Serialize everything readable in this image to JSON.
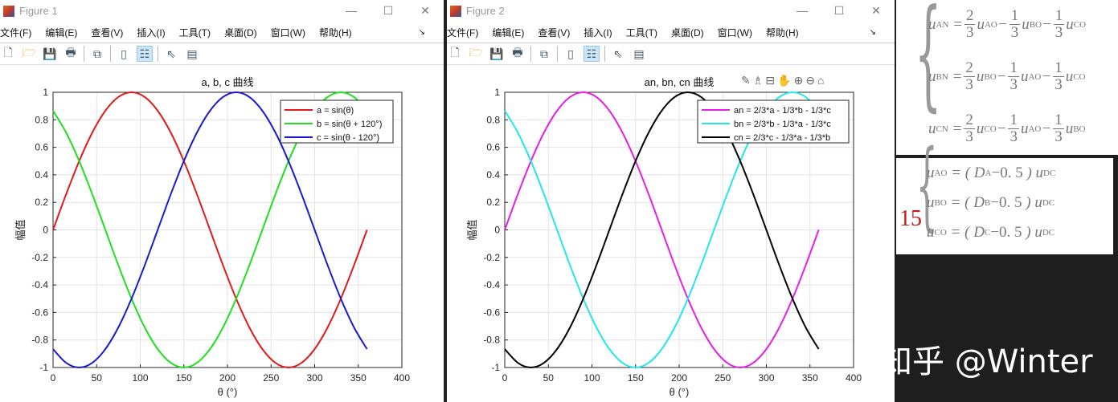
{
  "menus": [
    "文件(F)",
    "编辑(E)",
    "查看(V)",
    "插入(I)",
    "工具(T)",
    "桌面(D)",
    "窗口(W)",
    "帮助(H)"
  ],
  "window_controls": {
    "minimize": "—",
    "maximize": "☐",
    "close": "✕"
  },
  "figures": [
    {
      "title": "Figure 1"
    },
    {
      "title": "Figure 2"
    }
  ],
  "chart_data": [
    {
      "type": "line",
      "title": "a, b, c 曲线",
      "xlabel": "θ (°)",
      "ylabel": "幅值",
      "xlim": [
        0,
        400
      ],
      "ylim": [
        -1,
        1
      ],
      "grid": true,
      "legend_position": "top-right",
      "xticks": [
        0,
        50,
        100,
        150,
        200,
        250,
        300,
        350,
        400
      ],
      "yticks": [
        -1,
        -0.8,
        -0.6,
        -0.4,
        -0.2,
        0,
        0.2,
        0.4,
        0.6,
        0.8,
        1
      ],
      "x": [
        0,
        15,
        30,
        45,
        60,
        75,
        90,
        105,
        120,
        135,
        150,
        165,
        180,
        195,
        210,
        225,
        240,
        255,
        270,
        285,
        300,
        315,
        330,
        345,
        360
      ],
      "series": [
        {
          "name": "a = sin(θ)",
          "color": "#e01b1b",
          "values": [
            0,
            0.259,
            0.5,
            0.707,
            0.866,
            0.966,
            1,
            0.966,
            0.866,
            0.707,
            0.5,
            0.259,
            0,
            -0.259,
            -0.5,
            -0.707,
            -0.866,
            -0.966,
            -1,
            -0.966,
            -0.866,
            -0.707,
            -0.5,
            -0.259,
            0
          ]
        },
        {
          "name": "b = sin(θ + 120°)",
          "color": "#1ee01e",
          "values": [
            0.866,
            0.707,
            0.5,
            0.259,
            0,
            -0.259,
            -0.5,
            -0.707,
            -0.866,
            -0.966,
            -1,
            -0.966,
            -0.866,
            -0.707,
            -0.5,
            -0.259,
            0,
            0.259,
            0.5,
            0.707,
            0.866,
            0.966,
            1,
            0.966,
            0.866
          ]
        },
        {
          "name": "c = sin(θ - 120°)",
          "color": "#1a1acc",
          "values": [
            -0.866,
            -0.966,
            -1,
            -0.966,
            -0.866,
            -0.707,
            -0.5,
            -0.259,
            0,
            0.259,
            0.5,
            0.707,
            0.866,
            0.966,
            1,
            0.966,
            0.866,
            0.707,
            0.5,
            0.259,
            0,
            -0.259,
            -0.5,
            -0.707,
            -0.866
          ]
        }
      ]
    },
    {
      "type": "line",
      "title": "an, bn, cn 曲线",
      "xlabel": "θ (°)",
      "ylabel": "幅值",
      "xlim": [
        0,
        400
      ],
      "ylim": [
        -1,
        1
      ],
      "grid": true,
      "legend_position": "top-right",
      "xticks": [
        0,
        50,
        100,
        150,
        200,
        250,
        300,
        350,
        400
      ],
      "yticks": [
        -1,
        -0.8,
        -0.6,
        -0.4,
        -0.2,
        0,
        0.2,
        0.4,
        0.6,
        0.8,
        1
      ],
      "x": [
        0,
        15,
        30,
        45,
        60,
        75,
        90,
        105,
        120,
        135,
        150,
        165,
        180,
        195,
        210,
        225,
        240,
        255,
        270,
        285,
        300,
        315,
        330,
        345,
        360
      ],
      "series": [
        {
          "name": "an = 2/3*a - 1/3*b - 1/3*c",
          "color": "#e61ee6",
          "values": [
            0,
            0.259,
            0.5,
            0.707,
            0.866,
            0.966,
            1,
            0.966,
            0.866,
            0.707,
            0.5,
            0.259,
            0,
            -0.259,
            -0.5,
            -0.707,
            -0.866,
            -0.966,
            -1,
            -0.966,
            -0.866,
            -0.707,
            -0.5,
            -0.259,
            0
          ]
        },
        {
          "name": "bn = 2/3*b - 1/3*a - 1/3*c",
          "color": "#22e8e8",
          "values": [
            0.866,
            0.707,
            0.5,
            0.259,
            0,
            -0.259,
            -0.5,
            -0.707,
            -0.866,
            -0.966,
            -1,
            -0.966,
            -0.866,
            -0.707,
            -0.5,
            -0.259,
            0,
            0.259,
            0.5,
            0.707,
            0.866,
            0.966,
            1,
            0.966,
            0.866
          ]
        },
        {
          "name": "cn = 2/3*c - 1/3*a - 1/3*b",
          "color": "#000000",
          "values": [
            -0.866,
            -0.966,
            -1,
            -0.966,
            -0.866,
            -0.707,
            -0.5,
            -0.259,
            0,
            0.259,
            0.5,
            0.707,
            0.866,
            0.966,
            1,
            0.966,
            0.866,
            0.707,
            0.5,
            0.259,
            0,
            -0.259,
            -0.5,
            -0.707,
            -0.866
          ]
        }
      ]
    }
  ],
  "equations": {
    "set1": [
      {
        "lhs": "u",
        "lhs_sub": "AN",
        "t1": "u",
        "t1_sub": "AO",
        "t2": "u",
        "t2_sub": "BO",
        "t3": "u",
        "t3_sub": "CO"
      },
      {
        "lhs": "u",
        "lhs_sub": "BN",
        "t1": "u",
        "t1_sub": "BO",
        "t2": "u",
        "t2_sub": "AO",
        "t3": "u",
        "t3_sub": "CO"
      },
      {
        "lhs": "u",
        "lhs_sub": "CN",
        "t1": "u",
        "t1_sub": "CO",
        "t2": "u",
        "t2_sub": "AO",
        "t3": "u",
        "t3_sub": "BO"
      }
    ],
    "fractions": {
      "two": "2",
      "one": "1",
      "three": "3"
    },
    "set2_label": "15",
    "set2": [
      {
        "lhs_sub": "AO",
        "d_sub": "A"
      },
      {
        "lhs_sub": "BO",
        "d_sub": "B"
      },
      {
        "lhs_sub": "CO",
        "d_sub": "C"
      }
    ],
    "set2_u": "u",
    "set2_d": "D",
    "set2_const": "−0. 5",
    "set2_rhs_sub": "DC"
  },
  "watermark": "知乎 @Winter"
}
